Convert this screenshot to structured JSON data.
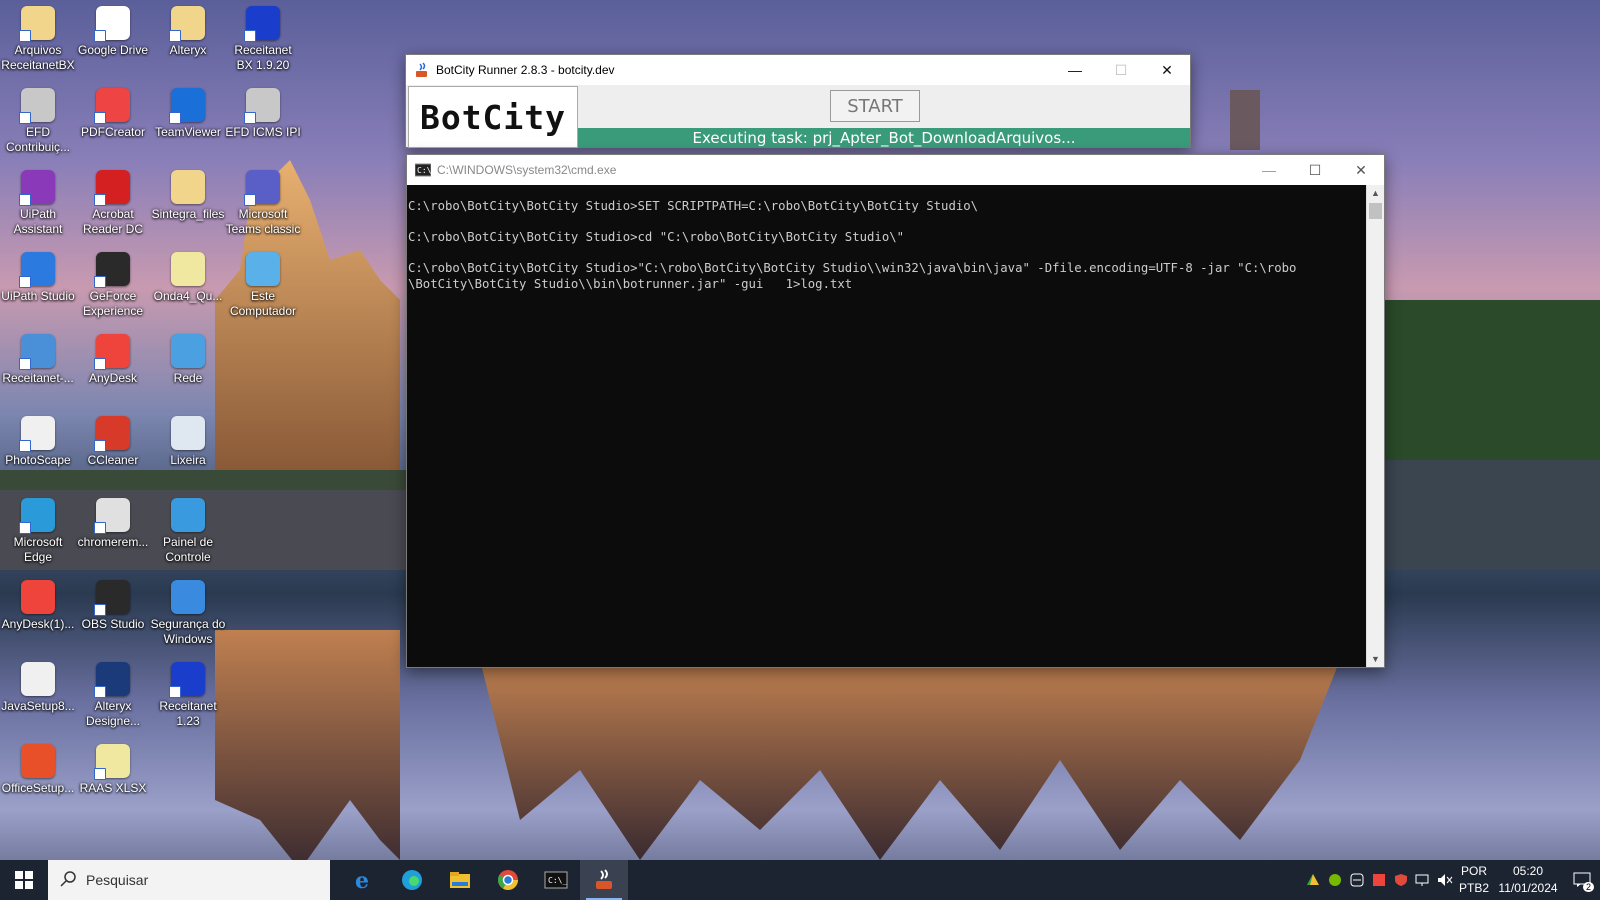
{
  "desktop_icons": [
    {
      "label": "Arquivos ReceitanetBX",
      "icon": "folder-icon",
      "color": "#f0d58a",
      "shortcut": true
    },
    {
      "label": "Google Drive",
      "icon": "google-drive-icon",
      "color": "#ffffff",
      "shortcut": true
    },
    {
      "label": "Alteryx",
      "icon": "folder-icon",
      "color": "#f0d58a",
      "shortcut": true
    },
    {
      "label": "Receitanet BX 1.9.20",
      "icon": "receitanet-icon",
      "color": "#1a3dcc",
      "shortcut": true
    },
    {
      "label": "EFD Contribuiç...",
      "icon": "efd-icon",
      "color": "#c8c8c8",
      "shortcut": true
    },
    {
      "label": "PDFCreator",
      "icon": "pdfcreator-icon",
      "color": "#e44",
      "shortcut": true
    },
    {
      "label": "TeamViewer",
      "icon": "teamviewer-icon",
      "color": "#1a6fd8",
      "shortcut": true
    },
    {
      "label": "EFD ICMS IPI",
      "icon": "efd-icon",
      "color": "#c8c8c8",
      "shortcut": true
    },
    {
      "label": "UiPath Assistant",
      "icon": "uipath-assistant-icon",
      "color": "#8a3ab8",
      "shortcut": true
    },
    {
      "label": "Acrobat Reader DC",
      "icon": "acrobat-icon",
      "color": "#d42020",
      "shortcut": true
    },
    {
      "label": "Sintegra_files",
      "icon": "folder-icon",
      "color": "#f0d58a",
      "shortcut": false
    },
    {
      "label": "Microsoft Teams classic",
      "icon": "teams-icon",
      "color": "#5a5fc8",
      "shortcut": true
    },
    {
      "label": "UiPath Studio",
      "icon": "uipath-studio-icon",
      "color": "#2a7ae0",
      "shortcut": true
    },
    {
      "label": "GeForce Experience",
      "icon": "geforce-icon",
      "color": "#2a2a2a",
      "shortcut": true
    },
    {
      "label": "Onda4_Qu...",
      "icon": "file-icon",
      "color": "#f0e8a0",
      "shortcut": false
    },
    {
      "label": "Este Computador",
      "icon": "computer-icon",
      "color": "#5ab0e8",
      "shortcut": false
    },
    {
      "label": "Receitanet-...",
      "icon": "installer-icon",
      "color": "#4a90d8",
      "shortcut": true
    },
    {
      "label": "AnyDesk",
      "icon": "anydesk-icon",
      "color": "#ef443b",
      "shortcut": true
    },
    {
      "label": "Rede",
      "icon": "network-icon",
      "color": "#4aa0e0",
      "shortcut": false
    },
    {
      "label": "PhotoScape",
      "icon": "photoscape-icon",
      "color": "#f0f0f0",
      "shortcut": true
    },
    {
      "label": "CCleaner",
      "icon": "ccleaner-icon",
      "color": "#d83a2a",
      "shortcut": true
    },
    {
      "label": "Lixeira",
      "icon": "recycle-bin-icon",
      "color": "#dfe8f0",
      "shortcut": false
    },
    {
      "label": "Microsoft Edge",
      "icon": "edge-icon",
      "color": "#2a9ad8",
      "shortcut": true
    },
    {
      "label": "chromerem...",
      "icon": "installer-icon",
      "color": "#e0e0e0",
      "shortcut": true
    },
    {
      "label": "Painel de Controle",
      "icon": "control-panel-icon",
      "color": "#3a9ae0",
      "shortcut": false
    },
    {
      "label": "AnyDesk(1)...",
      "icon": "anydesk-icon",
      "color": "#ef443b",
      "shortcut": false
    },
    {
      "label": "OBS Studio",
      "icon": "obs-icon",
      "color": "#2a2a2a",
      "shortcut": true
    },
    {
      "label": "Segurança do Windows",
      "icon": "windows-security-icon",
      "color": "#3a8ae0",
      "shortcut": false
    },
    {
      "label": "JavaSetup8...",
      "icon": "java-setup-icon",
      "color": "#f0f0f0",
      "shortcut": false
    },
    {
      "label": "Alteryx Designe...",
      "icon": "alteryx-designer-icon",
      "color": "#1a3a7a",
      "shortcut": true
    },
    {
      "label": "Receitanet 1.23",
      "icon": "receitanet-icon",
      "color": "#1a3dcc",
      "shortcut": true
    },
    {
      "label": "OfficeSetup...",
      "icon": "office-setup-icon",
      "color": "#e8502a",
      "shortcut": false
    },
    {
      "label": "RAAS XLSX",
      "icon": "file-icon",
      "color": "#f0e8a0",
      "shortcut": true
    }
  ],
  "botcity": {
    "title": "BotCity Runner 2.8.3 - botcity.dev",
    "logo_text": "BotCity",
    "start_label": "START",
    "status_text": "Executing task: prj_Apter_Bot_DownloadArquivos...",
    "status_color": "#3a9b7a"
  },
  "cmd": {
    "title": "C:\\WINDOWS\\system32\\cmd.exe",
    "lines": [
      "C:\\robo\\BotCity\\BotCity Studio>SET SCRIPTPATH=C:\\robo\\BotCity\\BotCity Studio\\",
      "",
      "C:\\robo\\BotCity\\BotCity Studio>cd \"C:\\robo\\BotCity\\BotCity Studio\\\"",
      "",
      "C:\\robo\\BotCity\\BotCity Studio>\"C:\\robo\\BotCity\\BotCity Studio\\\\win32\\java\\bin\\java\" -Dfile.encoding=UTF-8 -jar \"C:\\robo",
      "\\BotCity\\BotCity Studio\\\\bin\\botrunner.jar\" -gui   1>log.txt"
    ]
  },
  "taskbar": {
    "search_placeholder": "Pesquisar",
    "apps": [
      {
        "name": "internet-explorer-icon",
        "active": false
      },
      {
        "name": "edge-icon",
        "active": false
      },
      {
        "name": "file-explorer-icon",
        "active": false
      },
      {
        "name": "chrome-icon",
        "active": false
      },
      {
        "name": "cmd-icon",
        "active": false
      },
      {
        "name": "java-icon",
        "active": true
      }
    ],
    "tray_icons": [
      "google-drive-icon",
      "nvidia-icon",
      "teamviewer-icon",
      "anydesk-icon",
      "security-icon",
      "network-icon",
      "volume-muted-icon"
    ],
    "lang_line1": "POR",
    "lang_line2": "PTB2",
    "time": "05:20",
    "date": "11/01/2024",
    "notifications": "2"
  }
}
